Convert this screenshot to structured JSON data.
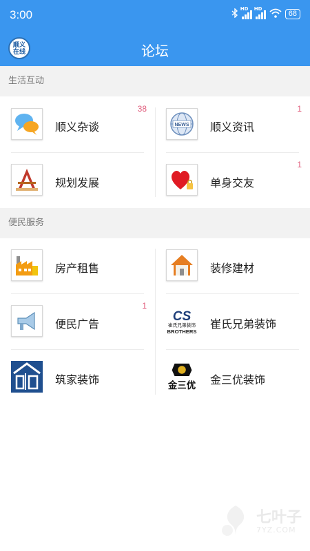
{
  "status_bar": {
    "time": "3:00",
    "battery": "68",
    "hd1": "HD",
    "hd2": "HD"
  },
  "app_bar": {
    "logo_text_top": "顺义",
    "logo_text_bottom": "在线",
    "title": "论坛"
  },
  "sections": [
    {
      "title": "生活互动",
      "items": [
        {
          "label": "顺义杂谈",
          "badge": "38",
          "icon": "chat-bubbles-icon"
        },
        {
          "label": "顺义资讯",
          "badge": "1",
          "icon": "news-globe-icon"
        },
        {
          "label": "规划发展",
          "badge": "",
          "icon": "drafting-tools-icon"
        },
        {
          "label": "单身交友",
          "badge": "1",
          "icon": "heart-lock-icon"
        }
      ]
    },
    {
      "title": "便民服务",
      "items": [
        {
          "label": "房产租售",
          "badge": "",
          "icon": "factory-icon"
        },
        {
          "label": "装修建材",
          "badge": "",
          "icon": "house-icon"
        },
        {
          "label": "便民广告",
          "badge": "1",
          "icon": "megaphone-icon"
        },
        {
          "label": "崔氏兄弟装饰",
          "badge": "",
          "icon": "brothers-logo-icon",
          "logo_top": "崔氏兄弟装饰",
          "logo_bottom": "BROTHERS"
        },
        {
          "label": "筑家装饰",
          "badge": "",
          "icon": "zhujia-logo-icon"
        },
        {
          "label": "金三优装饰",
          "badge": "",
          "icon": "jinsanyou-logo-icon",
          "logo_text": "金三优"
        }
      ]
    }
  ],
  "watermark": {
    "text": "七叶子",
    "sub": "7YZ.COM"
  }
}
